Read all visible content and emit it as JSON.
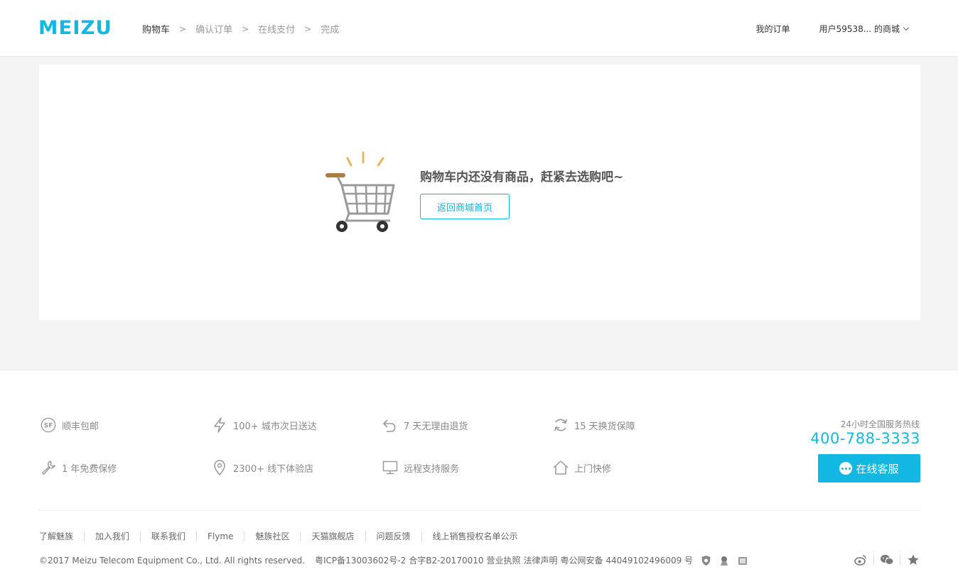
{
  "header": {
    "logo": "MEIZU",
    "breadcrumbs": [
      "购物车",
      "确认订单",
      "在线支付",
      "完成"
    ],
    "separator": ">",
    "my_orders": "我的订单",
    "user_store": "用户59538... 的商城"
  },
  "cart": {
    "empty_message": "购物车内还没有商品，赶紧去选购吧~",
    "back_button": "返回商城首页"
  },
  "footer": {
    "services": [
      {
        "icon": "sf-express-icon",
        "label": "顺丰包邮"
      },
      {
        "icon": "lightning-icon",
        "label": "100+ 城市次日送达"
      },
      {
        "icon": "return-arrow-icon",
        "label": "7 天无理由退货"
      },
      {
        "icon": "refresh-icon",
        "label": "15 天换货保障"
      },
      {
        "icon": "wrench-icon",
        "label": "1 年免费保修"
      },
      {
        "icon": "location-pin-icon",
        "label": "2300+ 线下体验店"
      },
      {
        "icon": "monitor-icon",
        "label": "远程支持服务"
      },
      {
        "icon": "house-icon",
        "label": "上门快修"
      }
    ],
    "hotline_label": "24小时全国服务热线",
    "hotline": "400-788-3333",
    "chat_button": "在线客服",
    "links": [
      "了解魅族",
      "加入我们",
      "联系我们",
      "Flyme",
      "魅族社区",
      "天猫旗舰店",
      "问题反馈",
      "线上销售授权名单公示"
    ],
    "copyright": "©2017 Meizu Telecom Equipment Co., Ltd. All rights reserved.",
    "icp": "粤ICP备13003602号-2",
    "license": "合字B2-20170010",
    "business_license": "营业执照",
    "legal": "法律声明",
    "police": "粤公网安备 44049102496009 号"
  },
  "colors": {
    "accent": "#12b7e2",
    "background": "#f4f4f4",
    "text_muted": "#888888"
  }
}
